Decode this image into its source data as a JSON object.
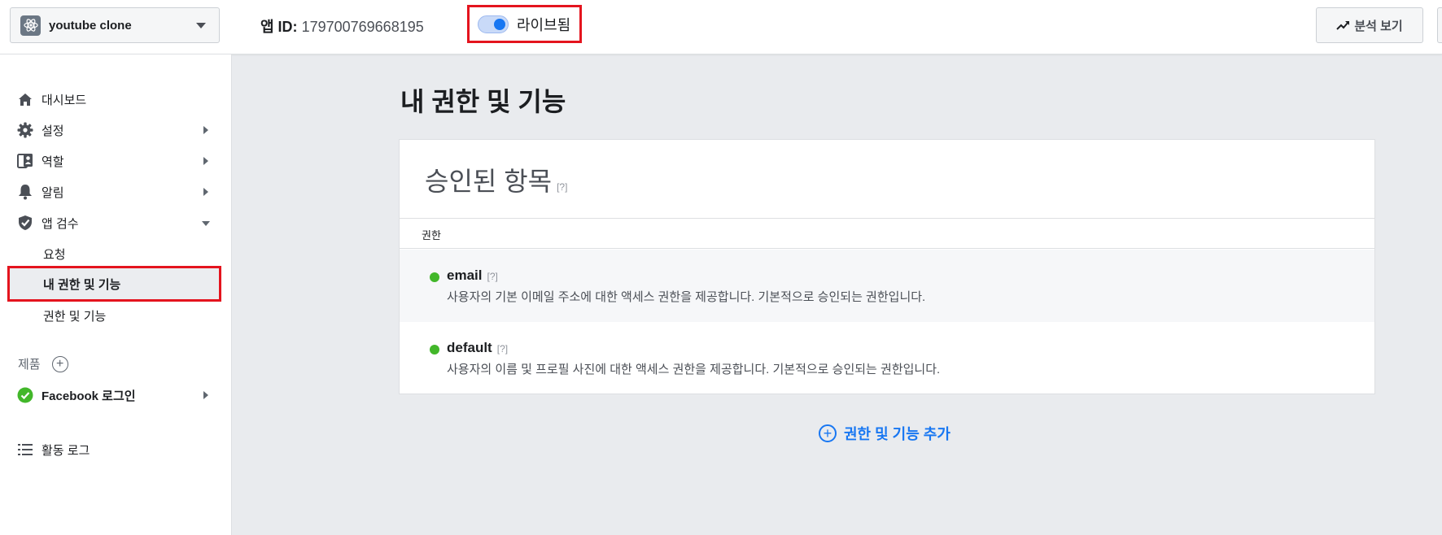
{
  "topbar": {
    "app_name": "youtube clone",
    "app_id_label": "앱 ID:",
    "app_id_value": "179700769668195",
    "live_label": "라이브됨",
    "analytics_label": "분석 보기"
  },
  "sidebar": {
    "items": [
      {
        "label": "대시보드",
        "icon": "home-icon"
      },
      {
        "label": "설정",
        "icon": "gear-icon"
      },
      {
        "label": "역할",
        "icon": "roles-icon"
      },
      {
        "label": "알림",
        "icon": "bell-icon"
      },
      {
        "label": "앱 검수",
        "icon": "shield-check-icon"
      }
    ],
    "sub_items": [
      {
        "label": "요청"
      },
      {
        "label": "내 권한 및 기능"
      },
      {
        "label": "권한 및 기능"
      }
    ],
    "products_label": "제품",
    "facebook_login_label": "Facebook 로그인",
    "activity_log_label": "활동 로그"
  },
  "main": {
    "page_title": "내 권한 및 기능",
    "card_title": "승인된 항목",
    "help_mark": "[?]",
    "column_header": "권한",
    "permissions": [
      {
        "name": "email",
        "help": "[?]",
        "description": "사용자의 기본 이메일 주소에 대한 액세스 권한을 제공합니다. 기본적으로 승인되는 권한입니다."
      },
      {
        "name": "default",
        "help": "[?]",
        "description": "사용자의 이름 및 프로필 사진에 대한 액세스 권한을 제공합니다. 기본적으로 승인되는 권한입니다."
      }
    ],
    "add_permission_label": "권한 및 기능 추가"
  },
  "colors": {
    "accent": "#1877f2",
    "status_green": "#42b72a",
    "highlight_red": "#e4141e"
  }
}
